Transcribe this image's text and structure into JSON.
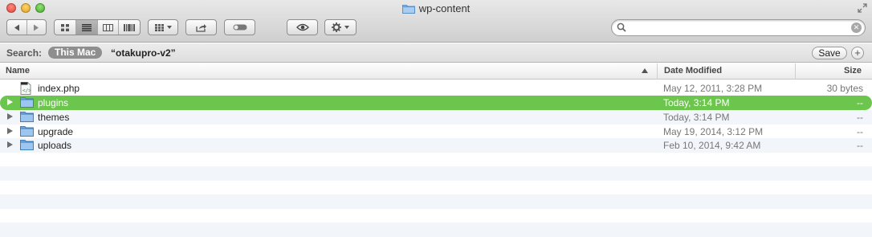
{
  "window": {
    "title": "wp-content"
  },
  "toolbar": {
    "back_icon": "chevron-left",
    "forward_icon": "chevron-right",
    "view_modes": [
      "icon-view",
      "list-view",
      "column-view",
      "coverflow-view"
    ],
    "active_view": "list-view",
    "arrange_icon": "grid-arrange",
    "share_icon": "share",
    "tags_icon": "toggle-pill",
    "quicklook_icon": "eye",
    "action_icon": "gear"
  },
  "search": {
    "value": "",
    "placeholder": ""
  },
  "scope": {
    "label": "Search:",
    "this_mac": "This Mac",
    "folder": "“otakupro-v2”",
    "save_label": "Save",
    "add_label": "+"
  },
  "columns": {
    "name": "Name",
    "date_modified": "Date Modified",
    "size": "Size",
    "sort_direction": "ascending"
  },
  "files": [
    {
      "name": "index.php",
      "date": "May 12, 2011, 3:28 PM",
      "size": "30 bytes",
      "kind": "php-file",
      "expandable": false,
      "selected": false
    },
    {
      "name": "plugins",
      "date": "Today, 3:14 PM",
      "size": "--",
      "kind": "folder",
      "expandable": true,
      "selected": true
    },
    {
      "name": "themes",
      "date": "Today, 3:14 PM",
      "size": "--",
      "kind": "folder",
      "expandable": true,
      "selected": false
    },
    {
      "name": "upgrade",
      "date": "May 19, 2014, 3:12 PM",
      "size": "--",
      "kind": "folder",
      "expandable": true,
      "selected": false
    },
    {
      "name": "uploads",
      "date": "Feb 10, 2014, 9:42 AM",
      "size": "--",
      "kind": "folder",
      "expandable": true,
      "selected": false
    }
  ],
  "colors": {
    "selection": "#6cc54d",
    "stripe": "#f2f5fa",
    "folder_blue": "#7fb3e6"
  }
}
